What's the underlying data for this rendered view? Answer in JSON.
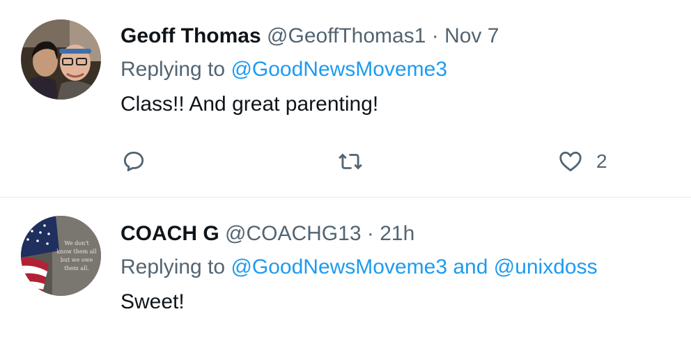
{
  "tweets": [
    {
      "author": "Geoff Thomas",
      "handle": "@GeoffThomas1",
      "separator": "·",
      "time": "Nov 7",
      "replying_prefix": "Replying to",
      "replying_to": "@GoodNewsMoveme3",
      "text": "Class!! And great parenting!",
      "like_count": "2",
      "icons": [
        "reply-icon",
        "retweet-icon",
        "like-icon"
      ]
    },
    {
      "author": "COACH G",
      "handle": "@COACHG13",
      "separator": "·",
      "time": "21h",
      "replying_prefix": "Replying to",
      "replying_to": "@GoodNewsMoveme3 and @unixdoss",
      "text": "Sweet!",
      "avatar_text": [
        "We don't",
        "know them all",
        "but we owe",
        "them all."
      ]
    }
  ],
  "colors": {
    "link": "#1d9bf0",
    "secondary_text": "#536471",
    "primary_text": "#0f1419",
    "divider": "#e7ebee"
  }
}
